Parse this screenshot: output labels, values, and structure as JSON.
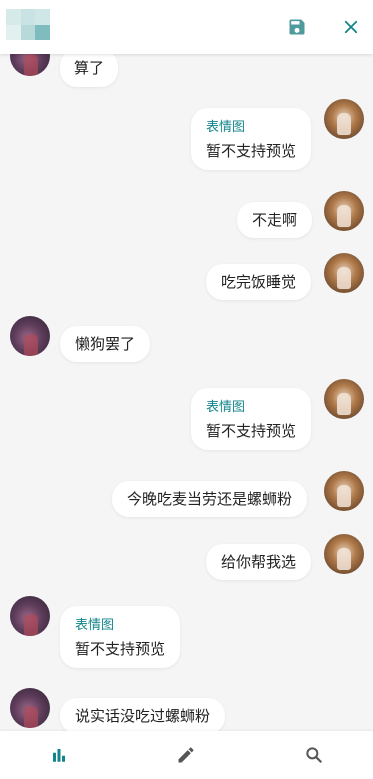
{
  "colors": {
    "accent": "#11858a",
    "bubble": "#ffffff",
    "background": "#f5f5f6",
    "icon_gray": "#555555"
  },
  "header": {
    "save_icon": "save-icon",
    "close_icon": "close-icon"
  },
  "messages": [
    {
      "side": "left",
      "text": "算了"
    },
    {
      "side": "right",
      "tag": "表情图",
      "text": "暂不支持预览"
    },
    {
      "side": "right",
      "text": "不走啊"
    },
    {
      "side": "right",
      "text": "吃完饭睡觉"
    },
    {
      "side": "left",
      "text": "懒狗罢了"
    },
    {
      "side": "right",
      "tag": "表情图",
      "text": "暂不支持预览"
    },
    {
      "side": "right",
      "text": "今晚吃麦当劳还是螺蛳粉"
    },
    {
      "side": "right",
      "text": "给你帮我选"
    },
    {
      "side": "left",
      "tag": "表情图",
      "text": "暂不支持预览"
    },
    {
      "side": "left",
      "text": "说实话没吃过螺蛳粉"
    }
  ],
  "bottom_nav": [
    "stats-icon",
    "edit-icon",
    "search-icon"
  ]
}
